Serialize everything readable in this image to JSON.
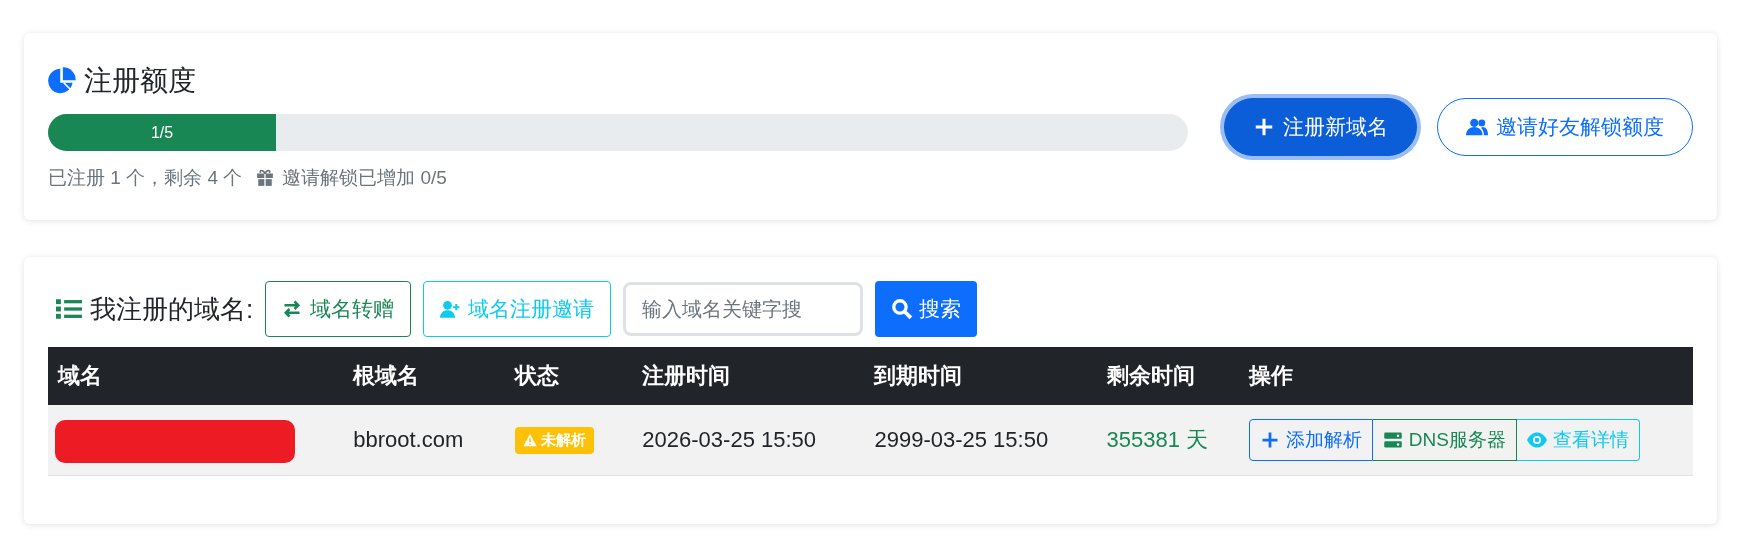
{
  "quota": {
    "title": "注册额度",
    "progress": {
      "level": 0.2,
      "label": "1/5"
    },
    "summary": "已注册 1 个，剩余 4 个",
    "invite_note": "邀请解锁已增加 0/5",
    "buttons": [
      {
        "kind": "primary",
        "label": "注册新域名"
      },
      {
        "kind": "outline",
        "label": "邀请好友解锁额度"
      }
    ]
  },
  "domains": {
    "title": "我注册的域名:",
    "actions": [
      {
        "kind": "transfer",
        "label": "域名转赠"
      },
      {
        "kind": "invite",
        "label": "域名注册邀请"
      }
    ],
    "search": {
      "placeholder": "输入域名关键字搜"
    },
    "search_button": "搜索",
    "table": {
      "columns": [
        "域名",
        "根域名",
        "状态",
        "注册时间",
        "到期时间",
        "剩余时间",
        "操作"
      ],
      "rows": [
        {
          "domain": {
            "kind": "redacted"
          },
          "root": "bbroot.com",
          "status": "未解析",
          "registered": "2026-03-25 15:50",
          "expires": "2999-03-25 15:50",
          "remaining": "355381 天",
          "operations": [
            {
              "kind": "add",
              "label": "添加解析"
            },
            {
              "kind": "dns",
              "label": "DNS服务器"
            },
            {
              "kind": "view",
              "label": "查看详情"
            }
          ]
        }
      ]
    }
  }
}
